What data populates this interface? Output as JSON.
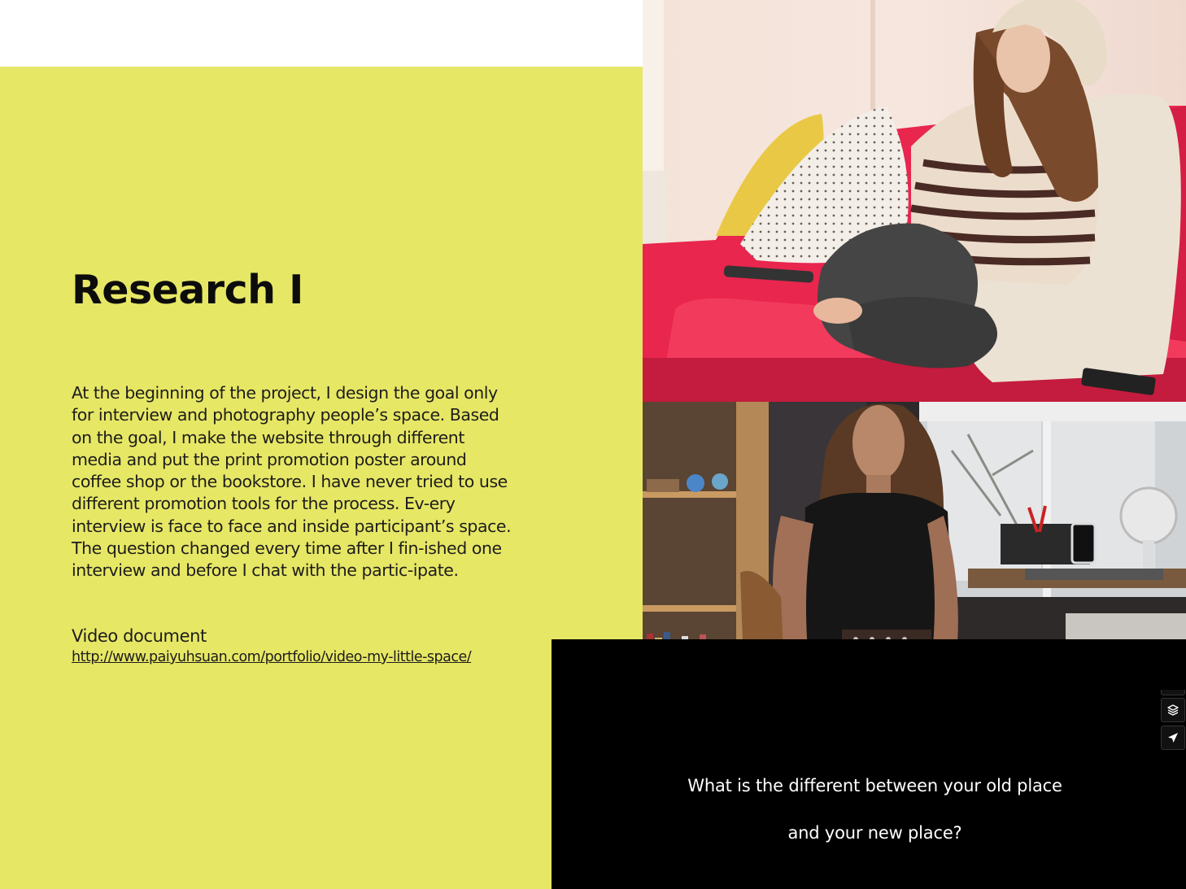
{
  "slide": {
    "title": "Research I",
    "body": "At the beginning of the project, I design the goal only for interview and photography people’s space. Based on the goal, I make the website through different media and put the print promotion poster around coffee shop or the bookstore. I have never tried to use different promotion tools for the process. Ev-ery interview is face to face and inside participant’s space. The question changed every time after I fin-ished one interview and before I chat with the partic-ipate.",
    "video_label": "Video document",
    "video_link": "http://www.paiyuhsuan.com/portfolio/video-my-little-space/"
  },
  "video": {
    "subtitle_line1": "What is the different between your old place",
    "subtitle_line2": "and your new place?"
  },
  "side_toolbar": {
    "icons": [
      "layers-icon",
      "send-icon"
    ]
  },
  "colors": {
    "panel_yellow": "#e7e766",
    "text": "#1d1d1b",
    "video_bg": "#000000"
  }
}
